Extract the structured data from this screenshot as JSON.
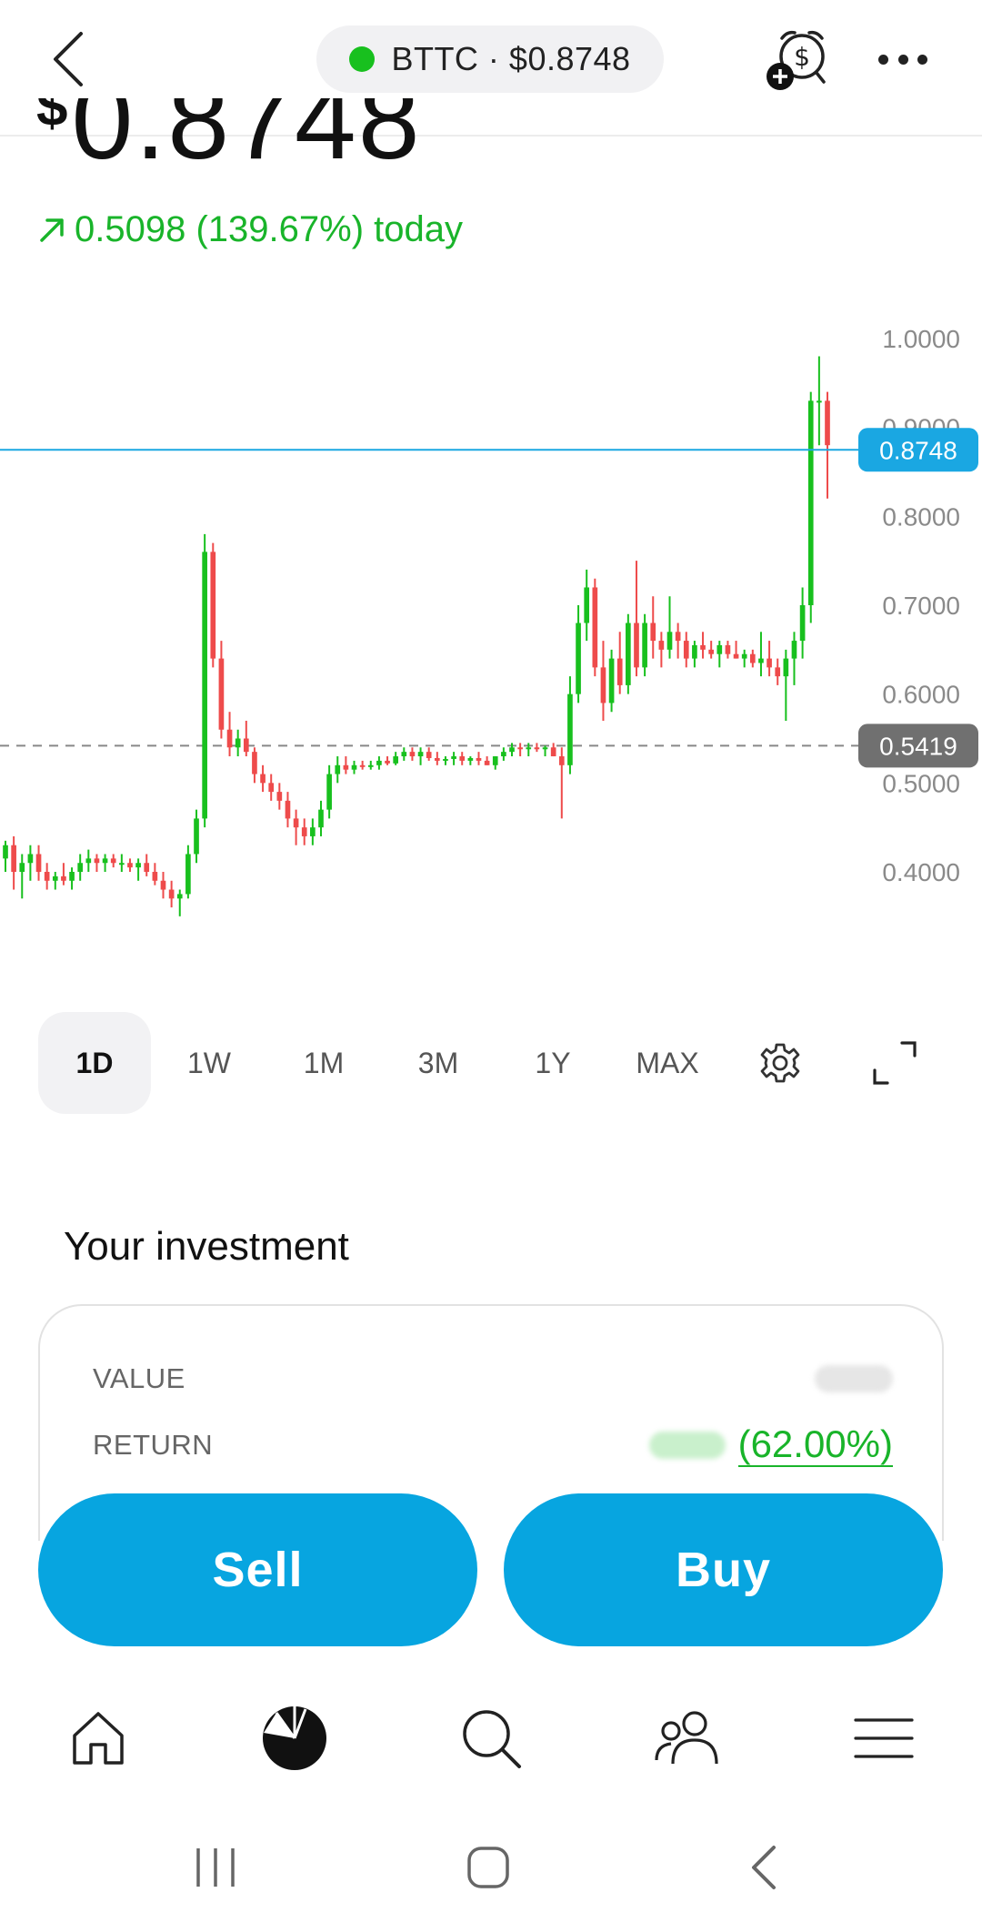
{
  "header": {
    "ticker_label": "BTTC · $0.8748",
    "status_color": "#18c01e"
  },
  "price": {
    "currency_symbol": "$",
    "value": "0.8748",
    "change_text": "0.5098 (139.67%) today",
    "change_color": "#19b42a"
  },
  "chart_data": {
    "type": "candlestick",
    "y_ticks": [
      "1.0000",
      "0.9000",
      "0.8000",
      "0.7000",
      "0.6000",
      "0.5000",
      "0.4000"
    ],
    "ylim": [
      0.35,
      1.05
    ],
    "current_price_label": "0.8748",
    "current_price": 0.8748,
    "reference_price_label": "0.5419",
    "reference_price": 0.5419,
    "up_color": "#18c01e",
    "down_color": "#ee4b4b",
    "current_line_color": "#1aa7e2",
    "candles": [
      [
        0.415,
        0.435,
        0.4,
        0.43
      ],
      [
        0.43,
        0.44,
        0.38,
        0.4
      ],
      [
        0.4,
        0.42,
        0.37,
        0.41
      ],
      [
        0.41,
        0.43,
        0.39,
        0.42
      ],
      [
        0.42,
        0.43,
        0.39,
        0.4
      ],
      [
        0.4,
        0.41,
        0.38,
        0.39
      ],
      [
        0.39,
        0.4,
        0.38,
        0.395
      ],
      [
        0.395,
        0.41,
        0.385,
        0.39
      ],
      [
        0.39,
        0.405,
        0.38,
        0.4
      ],
      [
        0.4,
        0.42,
        0.39,
        0.41
      ],
      [
        0.41,
        0.425,
        0.4,
        0.415
      ],
      [
        0.415,
        0.42,
        0.4,
        0.41
      ],
      [
        0.41,
        0.42,
        0.4,
        0.415
      ],
      [
        0.415,
        0.42,
        0.405,
        0.41
      ],
      [
        0.41,
        0.42,
        0.4,
        0.41
      ],
      [
        0.41,
        0.415,
        0.4,
        0.405
      ],
      [
        0.405,
        0.415,
        0.39,
        0.41
      ],
      [
        0.41,
        0.42,
        0.395,
        0.4
      ],
      [
        0.4,
        0.41,
        0.385,
        0.39
      ],
      [
        0.39,
        0.4,
        0.37,
        0.38
      ],
      [
        0.38,
        0.39,
        0.36,
        0.37
      ],
      [
        0.37,
        0.38,
        0.35,
        0.375
      ],
      [
        0.375,
        0.43,
        0.37,
        0.42
      ],
      [
        0.42,
        0.47,
        0.41,
        0.46
      ],
      [
        0.46,
        0.78,
        0.45,
        0.76
      ],
      [
        0.76,
        0.77,
        0.63,
        0.64
      ],
      [
        0.64,
        0.66,
        0.55,
        0.56
      ],
      [
        0.56,
        0.58,
        0.53,
        0.54
      ],
      [
        0.54,
        0.56,
        0.53,
        0.55
      ],
      [
        0.55,
        0.57,
        0.53,
        0.535
      ],
      [
        0.535,
        0.54,
        0.5,
        0.51
      ],
      [
        0.51,
        0.52,
        0.49,
        0.5
      ],
      [
        0.5,
        0.51,
        0.48,
        0.49
      ],
      [
        0.49,
        0.5,
        0.47,
        0.48
      ],
      [
        0.48,
        0.49,
        0.45,
        0.46
      ],
      [
        0.46,
        0.47,
        0.43,
        0.45
      ],
      [
        0.45,
        0.46,
        0.43,
        0.44
      ],
      [
        0.44,
        0.46,
        0.43,
        0.45
      ],
      [
        0.45,
        0.48,
        0.44,
        0.47
      ],
      [
        0.47,
        0.52,
        0.46,
        0.51
      ],
      [
        0.51,
        0.53,
        0.5,
        0.52
      ],
      [
        0.52,
        0.53,
        0.51,
        0.515
      ],
      [
        0.515,
        0.525,
        0.51,
        0.52
      ],
      [
        0.52,
        0.525,
        0.515,
        0.518
      ],
      [
        0.518,
        0.525,
        0.515,
        0.52
      ],
      [
        0.52,
        0.53,
        0.515,
        0.525
      ],
      [
        0.525,
        0.53,
        0.52,
        0.522
      ],
      [
        0.522,
        0.535,
        0.52,
        0.53
      ],
      [
        0.53,
        0.54,
        0.525,
        0.535
      ],
      [
        0.535,
        0.54,
        0.525,
        0.53
      ],
      [
        0.53,
        0.54,
        0.52,
        0.535
      ],
      [
        0.535,
        0.54,
        0.525,
        0.528
      ],
      [
        0.528,
        0.535,
        0.52,
        0.525
      ],
      [
        0.525,
        0.53,
        0.52,
        0.527
      ],
      [
        0.527,
        0.535,
        0.52,
        0.53
      ],
      [
        0.53,
        0.535,
        0.52,
        0.525
      ],
      [
        0.525,
        0.53,
        0.52,
        0.528
      ],
      [
        0.528,
        0.535,
        0.52,
        0.525
      ],
      [
        0.525,
        0.53,
        0.52,
        0.52
      ],
      [
        0.52,
        0.53,
        0.515,
        0.53
      ],
      [
        0.53,
        0.54,
        0.525,
        0.535
      ],
      [
        0.535,
        0.545,
        0.53,
        0.54
      ],
      [
        0.54,
        0.545,
        0.53,
        0.538
      ],
      [
        0.538,
        0.545,
        0.53,
        0.54
      ],
      [
        0.54,
        0.545,
        0.535,
        0.538
      ],
      [
        0.538,
        0.542,
        0.53,
        0.54
      ],
      [
        0.54,
        0.545,
        0.53,
        0.53
      ],
      [
        0.53,
        0.54,
        0.46,
        0.52
      ],
      [
        0.52,
        0.62,
        0.51,
        0.6
      ],
      [
        0.6,
        0.7,
        0.59,
        0.68
      ],
      [
        0.68,
        0.74,
        0.66,
        0.72
      ],
      [
        0.72,
        0.73,
        0.62,
        0.63
      ],
      [
        0.63,
        0.66,
        0.57,
        0.59
      ],
      [
        0.59,
        0.65,
        0.58,
        0.64
      ],
      [
        0.64,
        0.67,
        0.6,
        0.61
      ],
      [
        0.61,
        0.69,
        0.6,
        0.68
      ],
      [
        0.68,
        0.75,
        0.62,
        0.63
      ],
      [
        0.63,
        0.69,
        0.62,
        0.68
      ],
      [
        0.68,
        0.71,
        0.64,
        0.66
      ],
      [
        0.66,
        0.67,
        0.63,
        0.65
      ],
      [
        0.65,
        0.71,
        0.64,
        0.67
      ],
      [
        0.67,
        0.68,
        0.64,
        0.66
      ],
      [
        0.66,
        0.67,
        0.63,
        0.64
      ],
      [
        0.64,
        0.66,
        0.63,
        0.655
      ],
      [
        0.655,
        0.67,
        0.64,
        0.65
      ],
      [
        0.65,
        0.66,
        0.64,
        0.645
      ],
      [
        0.645,
        0.66,
        0.63,
        0.655
      ],
      [
        0.655,
        0.66,
        0.64,
        0.645
      ],
      [
        0.645,
        0.66,
        0.64,
        0.64
      ],
      [
        0.64,
        0.65,
        0.63,
        0.645
      ],
      [
        0.645,
        0.65,
        0.63,
        0.635
      ],
      [
        0.635,
        0.67,
        0.62,
        0.64
      ],
      [
        0.64,
        0.66,
        0.62,
        0.63
      ],
      [
        0.63,
        0.64,
        0.61,
        0.62
      ],
      [
        0.62,
        0.65,
        0.57,
        0.64
      ],
      [
        0.64,
        0.67,
        0.61,
        0.66
      ],
      [
        0.66,
        0.72,
        0.64,
        0.7
      ],
      [
        0.7,
        0.94,
        0.68,
        0.93
      ],
      [
        0.93,
        0.98,
        0.88,
        0.93
      ],
      [
        0.93,
        0.94,
        0.82,
        0.88
      ]
    ]
  },
  "timeframes": {
    "items": [
      "1D",
      "1W",
      "1M",
      "3M",
      "1Y",
      "MAX"
    ],
    "active": "1D"
  },
  "investment": {
    "title": "Your investment",
    "value_label": "VALUE",
    "return_label": "RETURN",
    "return_pct": "(62.00%)"
  },
  "actions": {
    "sell_label": "Sell",
    "buy_label": "Buy",
    "button_color": "#07a5e0"
  },
  "nav": {
    "items": [
      "home-icon",
      "portfolio-icon",
      "search-icon",
      "community-icon",
      "menu-icon"
    ]
  }
}
